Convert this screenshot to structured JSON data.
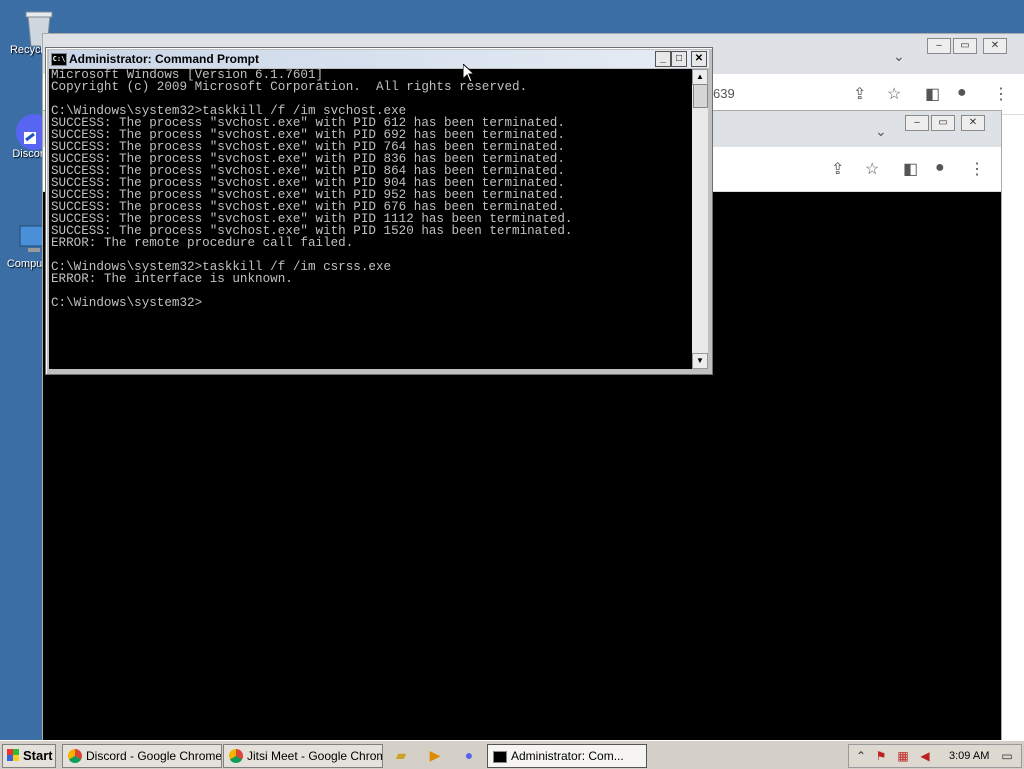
{
  "desktop": {
    "icons": [
      {
        "label": "Recycle Bin"
      },
      {
        "label": "Discord"
      },
      {
        "label": "Computer"
      }
    ]
  },
  "chrome_back": {
    "partial_text": "639"
  },
  "console": {
    "title": "Administrator: Command Prompt",
    "lines": [
      "Microsoft Windows [Version 6.1.7601]",
      "Copyright (c) 2009 Microsoft Corporation.  All rights reserved.",
      "",
      "C:\\Windows\\system32>taskkill /f /im svchost.exe",
      "SUCCESS: The process \"svchost.exe\" with PID 612 has been terminated.",
      "SUCCESS: The process \"svchost.exe\" with PID 692 has been terminated.",
      "SUCCESS: The process \"svchost.exe\" with PID 764 has been terminated.",
      "SUCCESS: The process \"svchost.exe\" with PID 836 has been terminated.",
      "SUCCESS: The process \"svchost.exe\" with PID 864 has been terminated.",
      "SUCCESS: The process \"svchost.exe\" with PID 904 has been terminated.",
      "SUCCESS: The process \"svchost.exe\" with PID 952 has been terminated.",
      "SUCCESS: The process \"svchost.exe\" with PID 676 has been terminated.",
      "SUCCESS: The process \"svchost.exe\" with PID 1112 has been terminated.",
      "SUCCESS: The process \"svchost.exe\" with PID 1520 has been terminated.",
      "ERROR: The remote procedure call failed.",
      "",
      "C:\\Windows\\system32>taskkill /f /im csrss.exe",
      "ERROR: The interface is unknown.",
      "",
      "C:\\Windows\\system32>"
    ]
  },
  "taskbar": {
    "start_label": "Start",
    "tasks": [
      {
        "label": "Discord - Google Chrome"
      },
      {
        "label": "Jitsi Meet - Google Chrome"
      },
      {
        "label": "Administrator: Com..."
      }
    ],
    "clock": "3:09 AM"
  },
  "colors": {
    "desktop": "#3a6ea5",
    "console_bg": "#000000",
    "console_fg": "#c0c0c0"
  }
}
